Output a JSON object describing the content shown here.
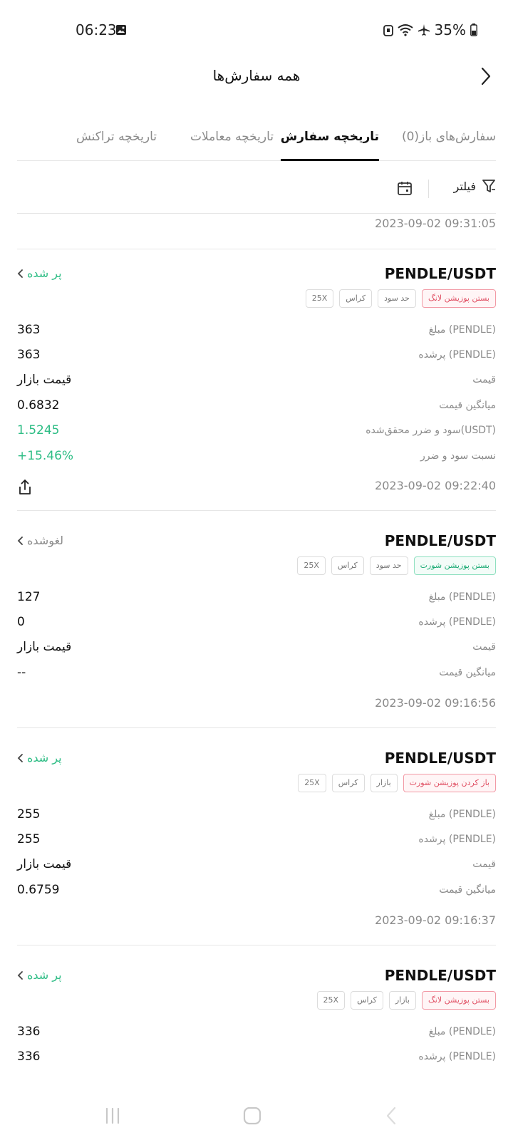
{
  "status_bar": {
    "time": "06:23",
    "battery": "35%"
  },
  "header": {
    "title": "همه سفارش‌ها"
  },
  "tabs": [
    {
      "label": "سفارش‌های باز(0)",
      "active": false
    },
    {
      "label": "تاریخچه سفارش",
      "active": true
    },
    {
      "label": "تاریخچه معاملات",
      "active": false
    },
    {
      "label": "تاریخچه تراکنش",
      "active": false
    }
  ],
  "filter_bar": {
    "filter_label": "فیلتر"
  },
  "top_entry": {
    "timestamp": "2023-09-02 09:31:05"
  },
  "orders": [
    {
      "pair": "PENDLE/USDT",
      "status": "پر شده",
      "tags": [
        "بستن پوزیشن لانگ",
        "حد سود",
        "کراس",
        "25X"
      ],
      "rows": [
        {
          "label": "مبلغ (PENDLE)",
          "value": "363"
        },
        {
          "label": "پرشده (PENDLE)",
          "value": "363"
        },
        {
          "label": "قیمت",
          "value": "قیمت بازار"
        },
        {
          "label": "میانگین قیمت",
          "value": "0.6832"
        },
        {
          "label": "سود و ضرر محقق‌شده(USDT)",
          "value": "1.5245"
        },
        {
          "label": "نسبت سود و ضرر",
          "value": "+15.46%"
        }
      ],
      "timestamp": "2023-09-02 09:22:40"
    },
    {
      "pair": "PENDLE/USDT",
      "status": "لغوشده",
      "tags": [
        "بستن پوزیشن شورت",
        "حد سود",
        "کراس",
        "25X"
      ],
      "rows": [
        {
          "label": "مبلغ (PENDLE)",
          "value": "127"
        },
        {
          "label": "پرشده (PENDLE)",
          "value": "0"
        },
        {
          "label": "قیمت",
          "value": "قیمت بازار"
        },
        {
          "label": "میانگین قیمت",
          "value": "--"
        }
      ],
      "timestamp": "2023-09-02 09:16:56"
    },
    {
      "pair": "PENDLE/USDT",
      "status": "پر شده",
      "tags": [
        "باز کردن پوزیشن شورت",
        "بازار",
        "کراس",
        "25X"
      ],
      "rows": [
        {
          "label": "مبلغ (PENDLE)",
          "value": "255"
        },
        {
          "label": "پرشده (PENDLE)",
          "value": "255"
        },
        {
          "label": "قیمت",
          "value": "قیمت بازار"
        },
        {
          "label": "میانگین قیمت",
          "value": "0.6759"
        }
      ],
      "timestamp": "2023-09-02 09:16:37"
    },
    {
      "pair": "PENDLE/USDT",
      "status": "پر شده",
      "tags": [
        "بستن پوزیشن لانگ",
        "بازار",
        "کراس",
        "25X"
      ],
      "rows": [
        {
          "label": "مبلغ (PENDLE)",
          "value": "336"
        },
        {
          "label": "پرشده (PENDLE)",
          "value": "336"
        }
      ]
    }
  ],
  "colors": {
    "profit_green": "#2ebd85",
    "loss_red": "#e04f63",
    "muted_gray": "#8a8a8a",
    "text": "#111111"
  }
}
